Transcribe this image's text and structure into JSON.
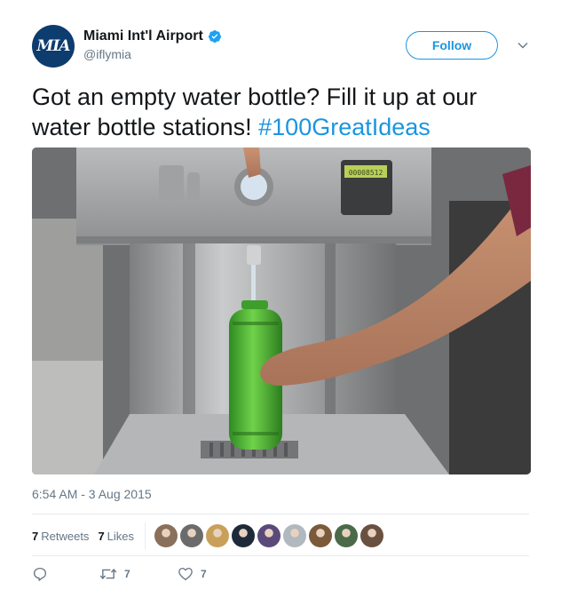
{
  "account": {
    "avatar_text": "MIA",
    "display_name": "Miami Int'l Airport",
    "handle": "@iflymia",
    "verified": true
  },
  "header": {
    "follow_label": "Follow"
  },
  "tweet": {
    "text": "Got an empty water bottle? Fill it up at our water bottle stations! ",
    "hashtag": "#100GreatIdeas",
    "timestamp": "6:54 AM - 3 Aug 2015"
  },
  "media": {
    "description_icon": "photo",
    "screen_text": "00008512"
  },
  "stats": {
    "retweets_count": "7",
    "retweets_label": "Retweets",
    "likes_count": "7",
    "likes_label": "Likes",
    "liker_colors": [
      "#8a6f5a",
      "#6b6b6b",
      "#c9a05a",
      "#1e2a3a",
      "#5a4a7a",
      "#b0b8c0",
      "#7a5a3a",
      "#4a6a4a",
      "#6a5040"
    ]
  },
  "actions": {
    "retweet_count": "7",
    "like_count": "7"
  },
  "colors": {
    "accent": "#1b95e0",
    "brand_navy": "#0d3c6e",
    "text": "#14171a",
    "muted": "#657786"
  }
}
